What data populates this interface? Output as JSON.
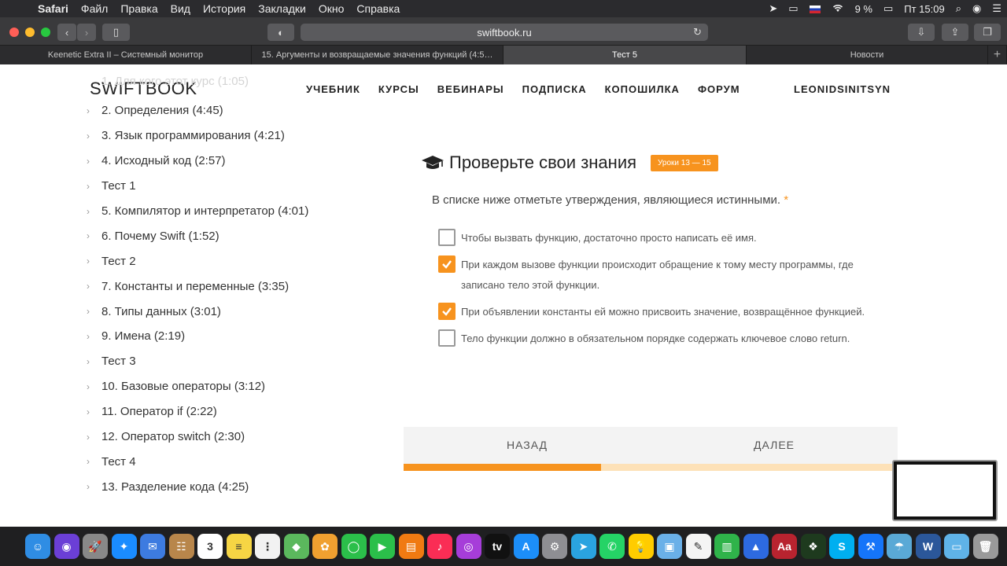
{
  "menubar": {
    "apple_glyph": "",
    "items": [
      "Safari",
      "Файл",
      "Правка",
      "Вид",
      "История",
      "Закладки",
      "Окно",
      "Справка"
    ],
    "battery": "9 %",
    "clock": "Пт 15:09",
    "status_icons": [
      "location-icon",
      "display-icon",
      "russia-flag-icon",
      "wifi-icon",
      "battery-icon",
      "search-icon",
      "siri-icon",
      "list-icon"
    ]
  },
  "toolbar": {
    "address": "swiftbook.ru"
  },
  "tabs": [
    {
      "label": "Keenetic Extra II – Системный монитор",
      "active": false
    },
    {
      "label": "15. Аргументы и возвращаемые значения функций (4:5…",
      "active": false
    },
    {
      "label": "Тест 5",
      "active": true
    },
    {
      "label": "Новости",
      "active": false
    }
  ],
  "site": {
    "logo": "SWIFTBOOK",
    "nav": [
      "УЧЕБНИК",
      "КУРСЫ",
      "ВЕБИНАРЫ",
      "ПОДПИСКА",
      "КОПОШИЛКА",
      "ФОРУМ"
    ],
    "user": "LEONIDSINITSYN"
  },
  "sidebar": {
    "faded_item": "1. Для кого этот курс (1:05)",
    "items": [
      "2. Определения (4:45)",
      "3. Язык программирования (4:21)",
      "4. Исходный код (2:57)",
      "Тест 1",
      "5. Компилятор и интерпретатор (4:01)",
      "6. Почему Swift (1:52)",
      "Тест 2",
      "7. Константы и переменные (3:35)",
      "8. Типы данных (3:01)",
      "9. Имена (2:19)",
      "Тест 3",
      "10. Базовые операторы (3:12)",
      "11. Оператор if (2:22)",
      "12. Оператор switch (2:30)",
      "Тест 4",
      "13. Разделение кода (4:25)"
    ]
  },
  "quiz": {
    "title": "Проверьте свои знания",
    "badge": "Уроки 13 — 15",
    "question": "В списке ниже отметьте утверждения, являющиеся истинными.",
    "required_mark": "*",
    "options": [
      {
        "text": "Чтобы вызвать функцию, достаточно просто написать её имя.",
        "checked": false
      },
      {
        "text": "При каждом вызове функции происходит обращение к тому месту программы, где записано тело этой функции.",
        "checked": true
      },
      {
        "text": "При объявлении константы ей можно присвоить значение, возвращённое функцией.",
        "checked": true
      },
      {
        "text": "Тело функции должно в обязательном порядке содержать ключевое слово return.",
        "checked": false
      }
    ],
    "back_label": "НАЗАД",
    "next_label": "ДАЛЕЕ",
    "progress_fraction": 0.4,
    "accent_color": "#f7931e"
  },
  "dock": [
    {
      "name": "finder-icon",
      "color": "#2f8de4",
      "glyph": "☺"
    },
    {
      "name": "siri-icon",
      "color": "#6b3fd6",
      "glyph": "◉"
    },
    {
      "name": "launchpad-icon",
      "color": "#888888",
      "glyph": "🚀"
    },
    {
      "name": "safari-icon",
      "color": "#1a8cff",
      "glyph": "✦"
    },
    {
      "name": "mail-stamp-icon",
      "color": "#3d7be0",
      "glyph": "✉"
    },
    {
      "name": "contacts-icon",
      "color": "#b8864b",
      "glyph": "☷"
    },
    {
      "name": "calendar-icon",
      "color": "#ffffff",
      "glyph": "3"
    },
    {
      "name": "notes-icon",
      "color": "#f6d544",
      "glyph": "≡"
    },
    {
      "name": "reminders-icon",
      "color": "#f2f2f2",
      "glyph": "⋮"
    },
    {
      "name": "maps-icon",
      "color": "#5bb85d",
      "glyph": "◆"
    },
    {
      "name": "photos-icon",
      "color": "#f0a030",
      "glyph": "✿"
    },
    {
      "name": "messages-icon",
      "color": "#2bbf4a",
      "glyph": "◯"
    },
    {
      "name": "facetime-icon",
      "color": "#2bbf4a",
      "glyph": "▶"
    },
    {
      "name": "books-icon",
      "color": "#f07a12",
      "glyph": "▤"
    },
    {
      "name": "music-icon",
      "color": "#fa2d55",
      "glyph": "♪"
    },
    {
      "name": "podcasts-icon",
      "color": "#a63dd9",
      "glyph": "◎"
    },
    {
      "name": "apple-tv-icon",
      "color": "#111111",
      "glyph": "tv"
    },
    {
      "name": "app-store-icon",
      "color": "#1c8ef9",
      "glyph": "A"
    },
    {
      "name": "system-preferences-icon",
      "color": "#8e8e93",
      "glyph": "⚙"
    },
    {
      "name": "telegram-icon",
      "color": "#2aa3e0",
      "glyph": "➤"
    },
    {
      "name": "whatsapp-icon",
      "color": "#25d366",
      "glyph": "✆"
    },
    {
      "name": "tips-icon",
      "color": "#ffcc00",
      "glyph": "💡"
    },
    {
      "name": "preview-icon",
      "color": "#6ab0e8",
      "glyph": "▣"
    },
    {
      "name": "textedit-icon",
      "color": "#f4f4f4",
      "glyph": "✎"
    },
    {
      "name": "numbers-icon",
      "color": "#2fb34a",
      "glyph": "▥"
    },
    {
      "name": "keynote-icon",
      "color": "#2d6ae0",
      "glyph": "▲"
    },
    {
      "name": "dictionary-icon",
      "color": "#b8232f",
      "glyph": "Aa"
    },
    {
      "name": "activity-monitor-icon",
      "color": "#1e3a1e",
      "glyph": "❖"
    },
    {
      "name": "skype-icon",
      "color": "#00aff0",
      "glyph": "S"
    },
    {
      "name": "xcode-icon",
      "color": "#1575f9",
      "glyph": "⚒"
    },
    {
      "name": "network-utility-icon",
      "color": "#5aa9d6",
      "glyph": "☂"
    },
    {
      "name": "word-icon",
      "color": "#2b579a",
      "glyph": "W"
    },
    {
      "name": "downloads-folder-icon",
      "color": "#5fb3e8",
      "glyph": "▭"
    },
    {
      "name": "trash-icon",
      "color": "#9a9a9a",
      "glyph": "🗑"
    }
  ]
}
